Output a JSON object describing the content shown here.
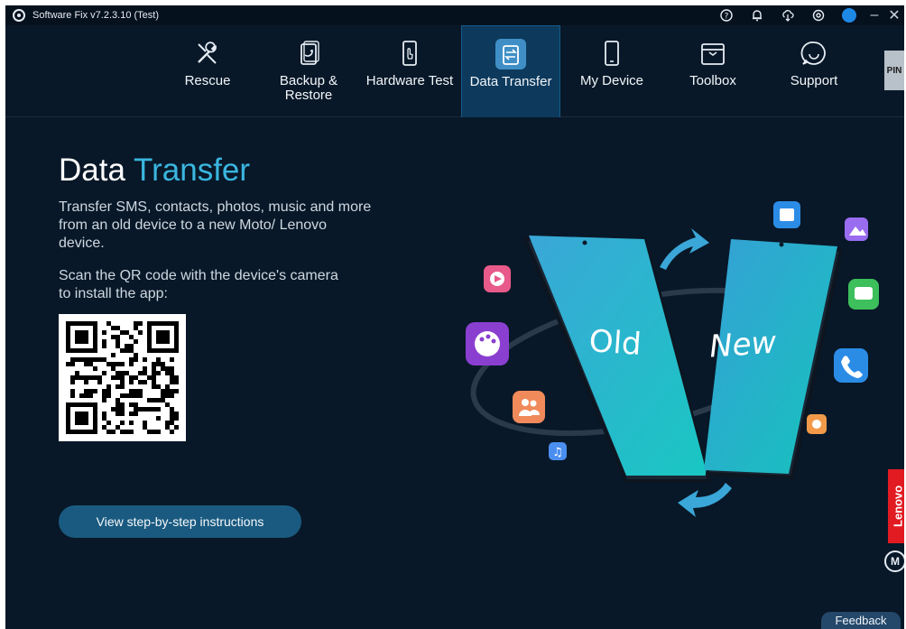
{
  "window": {
    "title": "Software Fix v7.2.3.10 (Test)"
  },
  "titlebar_icons": [
    "help-icon",
    "bell-icon",
    "cloud-download-icon",
    "settings-icon",
    "user-icon"
  ],
  "nav": {
    "tabs": [
      {
        "label": "Rescue",
        "icon": "tools-icon"
      },
      {
        "label": "Backup &\nRestore",
        "icon": "backup-icon"
      },
      {
        "label": "Hardware Test",
        "icon": "hardware-test-icon"
      },
      {
        "label": "Data Transfer",
        "icon": "data-transfer-icon",
        "active": true
      },
      {
        "label": "My Device",
        "icon": "phone-icon"
      },
      {
        "label": "Toolbox",
        "icon": "toolbox-icon"
      },
      {
        "label": "Support",
        "icon": "chat-icon"
      }
    ],
    "pin_label": "PIN"
  },
  "main": {
    "title_part1": "Data",
    "title_part2": "Transfer",
    "description": "Transfer SMS, contacts, photos, music and more from an old device to a new Moto/ Lenovo device.",
    "qr_instruction": "Scan the QR code with the device's camera to install the app:",
    "steps_button": "View step-by-step instructions"
  },
  "illustration": {
    "old_label": "Old",
    "new_label": "New"
  },
  "brand": {
    "lenovo": "Lenovo",
    "moto": "M"
  },
  "feedback_label": "Feedback",
  "colors": {
    "background": "#081828",
    "accent": "#3ab6e0",
    "active_tab": "#0d3a5c",
    "button": "#1a5a80",
    "lenovo_red": "#e21b22"
  }
}
